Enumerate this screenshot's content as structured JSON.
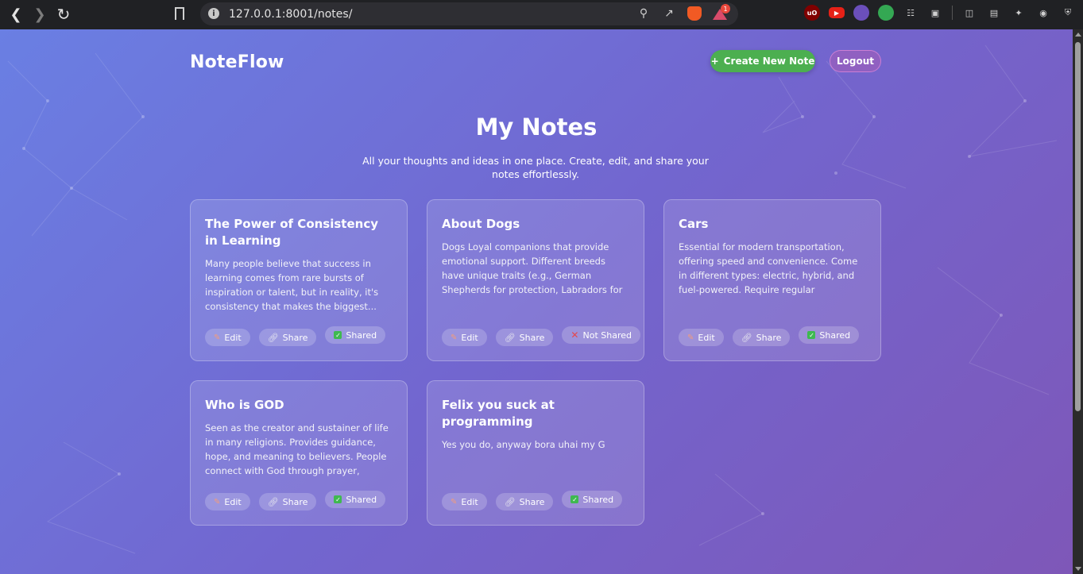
{
  "browser": {
    "url": "127.0.0.1:8001/notes/",
    "bat_badge": "1"
  },
  "header": {
    "brand": "NoteFlow",
    "create_label": "Create New Note",
    "create_icon": "+",
    "logout_label": "Logout"
  },
  "hero": {
    "title": "My Notes",
    "subtitle": "All your thoughts and ideas in one place. Create, edit, and share your notes effortlessly."
  },
  "actions": {
    "edit": "Edit",
    "share": "Share"
  },
  "notes": [
    {
      "title": "The Power of Consistency in Learning",
      "body": "Many people believe that success in learning comes from rare bursts of inspiration or talent, but in reality, it's consistency that makes the biggest...",
      "status": "Shared"
    },
    {
      "title": "About Dogs",
      "body": "Dogs Loyal companions that provide emotional support. Different breeds have unique traits (e.g., German Shepherds for protection, Labradors for friendliness).... Require care: feeding, exercise, training, and",
      "status": "Not Shared"
    },
    {
      "title": "Cars",
      "body": "Essential for modern transportation, offering speed and convenience. Come in different types: electric, hybrid, and fuel-powered. Require regular maintenance (oil changes,... tire checks, servicing) to stay reliable.",
      "status": "Shared"
    },
    {
      "title": "Who is GOD",
      "body": "Seen as the creator and sustainer of life in many religions. Provides guidance, hope, and meaning to believers. People connect with God through prayer, worship, and livi...",
      "status": "Shared"
    },
    {
      "title": "Felix you suck at programming",
      "body": "Yes you do, anyway bora uhai my G",
      "status": "Shared"
    }
  ],
  "colors": {
    "create_button": "#4caf50",
    "shared_check": "#3fb950",
    "not_shared_x": "#e5484d",
    "gradient_start": "#6a7fe3",
    "gradient_end": "#7e57b8"
  }
}
